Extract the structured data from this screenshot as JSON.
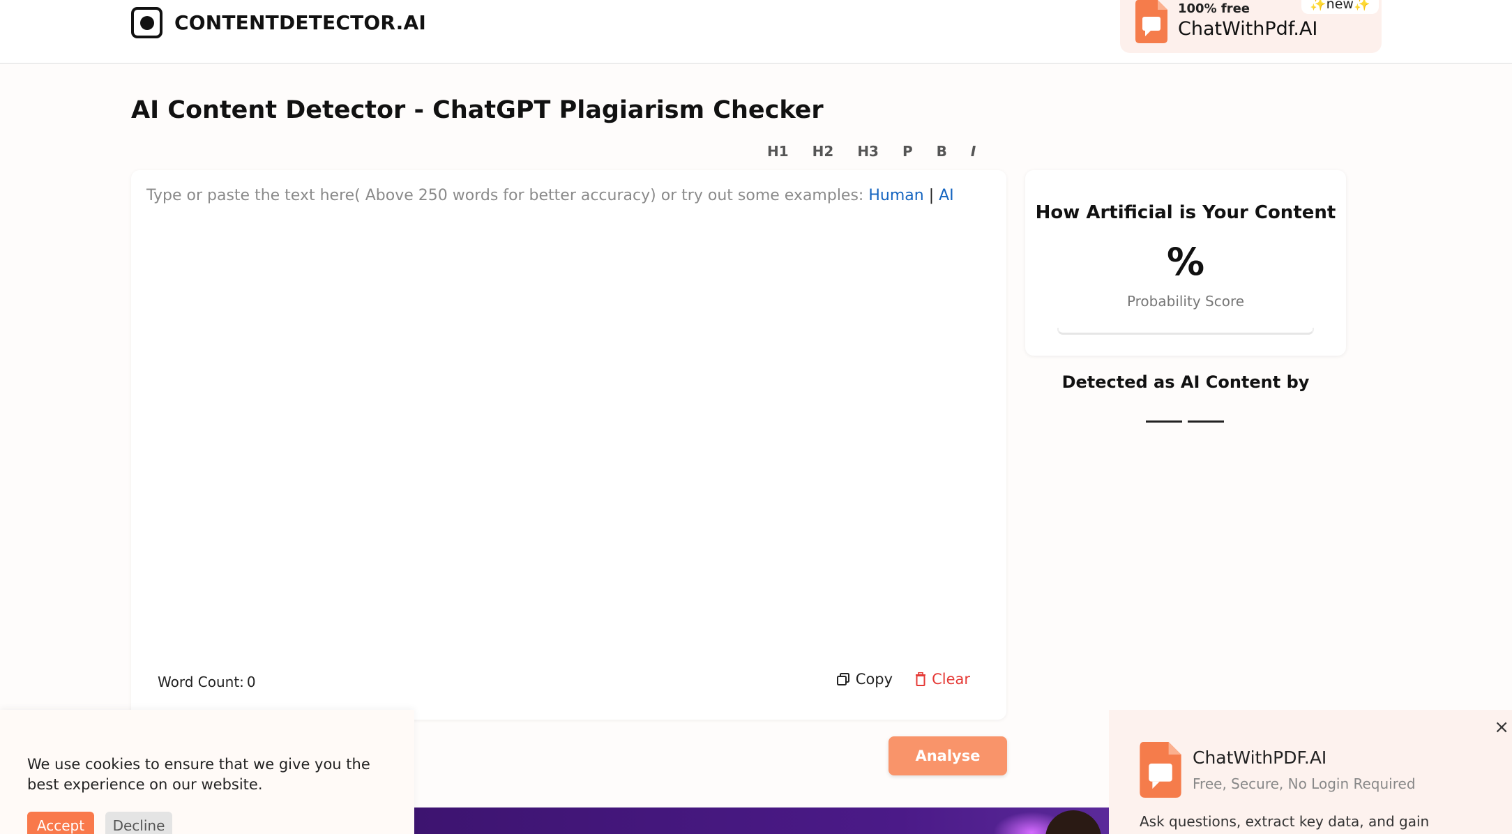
{
  "header": {
    "logo_text": "CONTENTDETECTOR.AI",
    "promo": {
      "free_label": "100% free",
      "title": "ChatWithPdf.AI",
      "new_label": "new"
    }
  },
  "page_title": "AI Content Detector - ChatGPT Plagiarism Checker",
  "toolbar": {
    "h1": "H1",
    "h2": "H2",
    "h3": "H3",
    "p": "P",
    "b": "B",
    "i": "I"
  },
  "editor": {
    "placeholder": "Type or paste the text here( Above 250 words for better accuracy) or try out some examples: ",
    "example_human": "Human",
    "separator": "|",
    "example_ai": "AI",
    "word_count_label": "Word Count:",
    "word_count_value": "0",
    "copy_label": "Copy",
    "clear_label": "Clear"
  },
  "result": {
    "title": "How Artificial is Your Content",
    "percent": "%",
    "score_label": "Probability Score",
    "detected_title": "Detected as AI Content by"
  },
  "analyse_label": "Analyse",
  "cookie": {
    "text": "We use cookies to ensure that we give you the best experience on our website.",
    "accept_label": "Accept",
    "decline_label": "Decline"
  },
  "popup": {
    "title": "ChatWithPDF.AI",
    "subtitle": "Free, Secure, No Login Required",
    "description": "Ask questions, extract key data, and gain",
    "close_symbol": "×"
  },
  "colors": {
    "accent": "#f9946a",
    "link": "#1565c0",
    "danger": "#e53935",
    "promo_icon": "#f57c4b"
  },
  "icons": [
    "logo-icon",
    "pdf-chat-icon",
    "copy-icon",
    "trash-icon",
    "close-icon",
    "sparkle-icon"
  ]
}
